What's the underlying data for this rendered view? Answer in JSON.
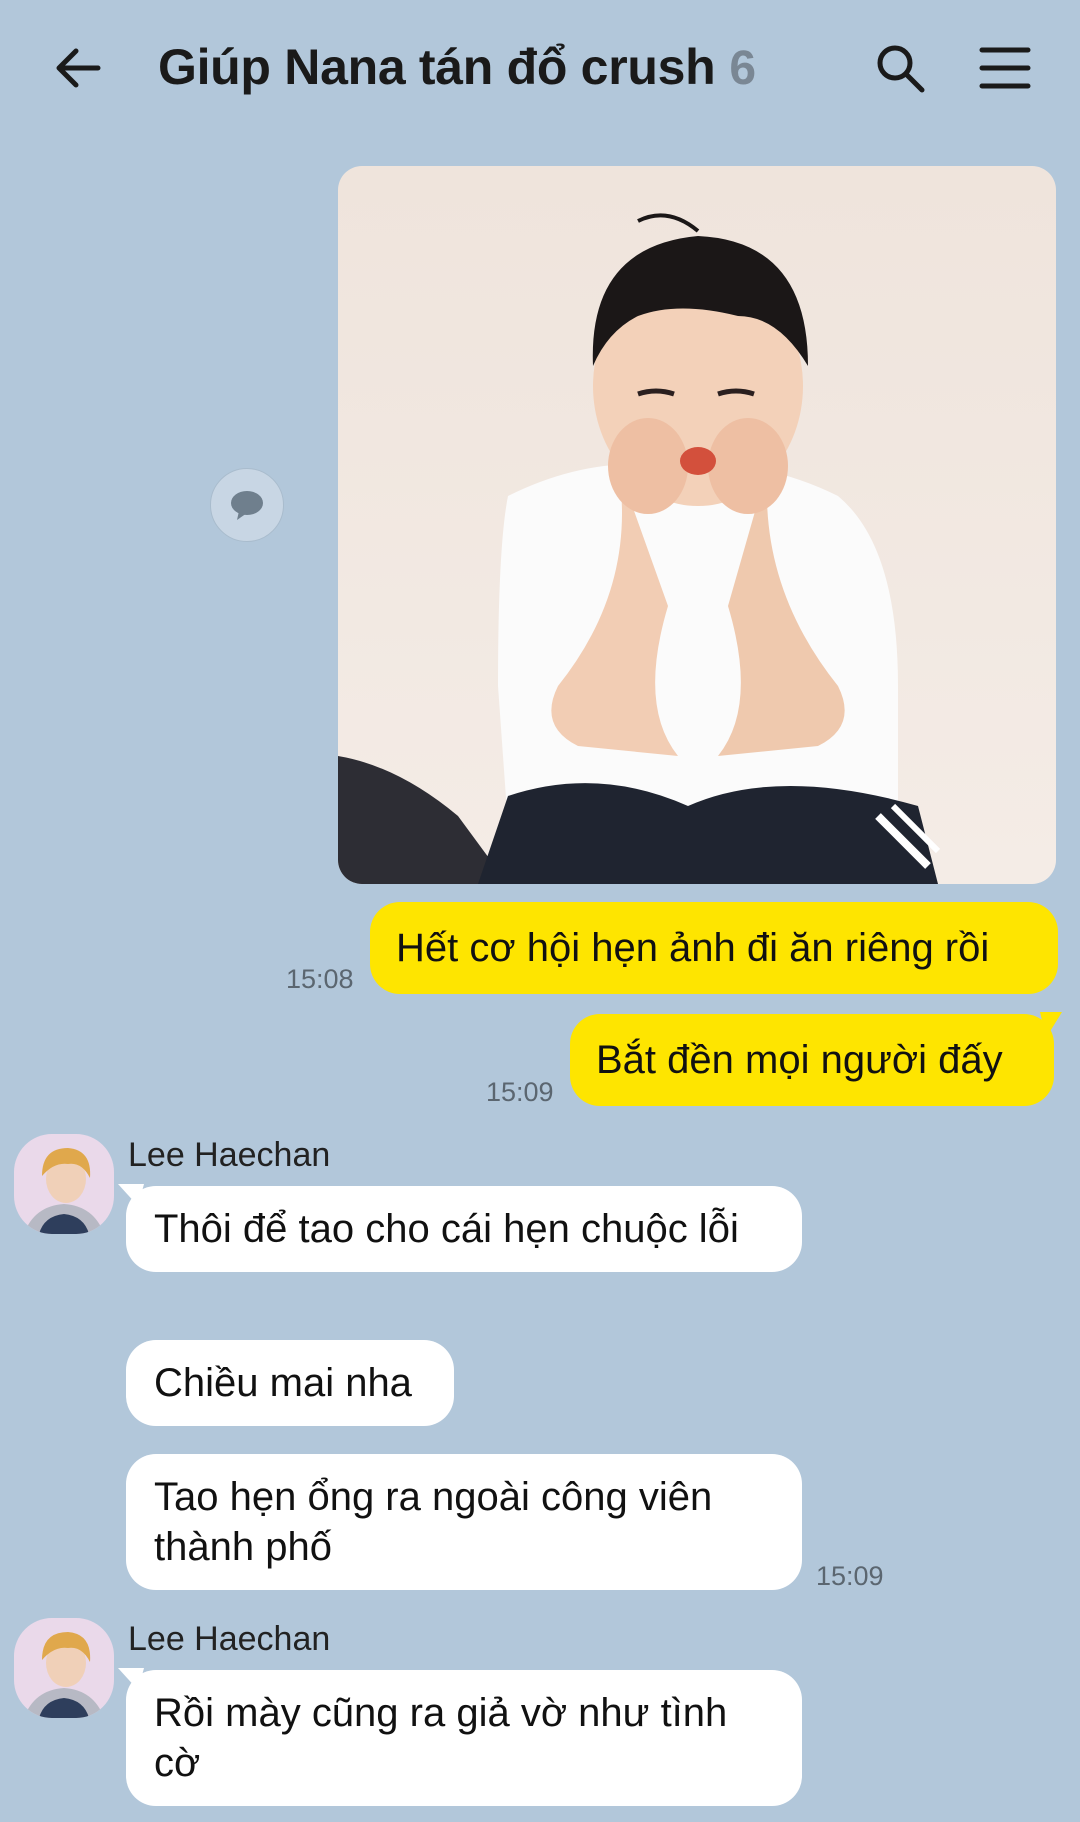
{
  "header": {
    "title": "Giúp Nana tán đổ crush",
    "member_count": "6"
  },
  "messages": {
    "photo": {
      "description_icon": "photo-message"
    },
    "me_1": {
      "text": "Hết cơ hội hẹn ảnh đi ăn riêng rồi",
      "time": "15:08"
    },
    "me_2": {
      "text": "Bắt đền mọi người đấy",
      "time": "15:09"
    },
    "group_1": {
      "sender": "Lee Haechan",
      "msg_1": "Thôi để tao cho cái hẹn chuộc lỗi",
      "msg_2": "Chiều mai nha",
      "msg_3": "Tao hẹn ổng ra ngoài công viên thành phố",
      "time": "15:09"
    },
    "group_2": {
      "sender": "Lee Haechan",
      "msg_1": "Rồi mày cũng ra giả vờ như tình cờ"
    }
  },
  "colors": {
    "background": "#b2c7da",
    "my_bubble": "#fee500",
    "other_bubble": "#ffffff"
  }
}
